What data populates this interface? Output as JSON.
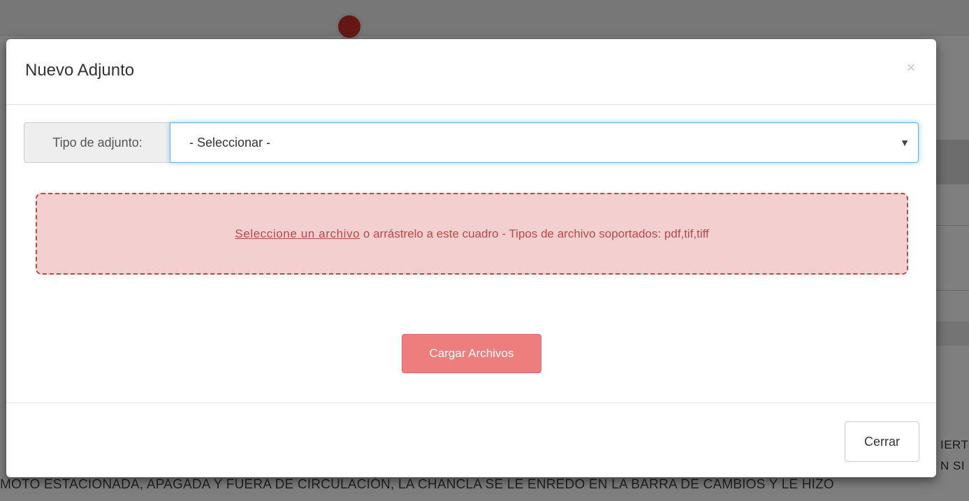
{
  "background": {
    "side_text_line1": "IERT",
    "side_text_line2": "N SI",
    "bottom_text": "MOTO ESTACIONADA, APAGADA Y FUERA DE CIRCULACIÓN, LA CHANCLA SE LE ENREDO EN LA BARRA DE CAMBIOS Y LE HIZO"
  },
  "modal": {
    "title": "Nuevo Adjunto",
    "close_icon_glyph": "×",
    "attachment_type": {
      "label": "Tipo de adjunto:",
      "selected_value": "- Seleccionar -",
      "arrow_glyph": "▼"
    },
    "dropzone": {
      "link_text": "Seleccione un archivo",
      "rest_text": " o arrástrelo a este cuadro - Tipos de archivo soportados: pdf,tif,tiff"
    },
    "upload_button_label": "Cargar Archivos",
    "footer_close_label": "Cerrar"
  },
  "colors": {
    "dropzone_bg": "#f3cfcf",
    "dropzone_border": "#b94a48",
    "upload_button_bg": "#ee7d7d",
    "select_focus_border": "#66afe9"
  }
}
